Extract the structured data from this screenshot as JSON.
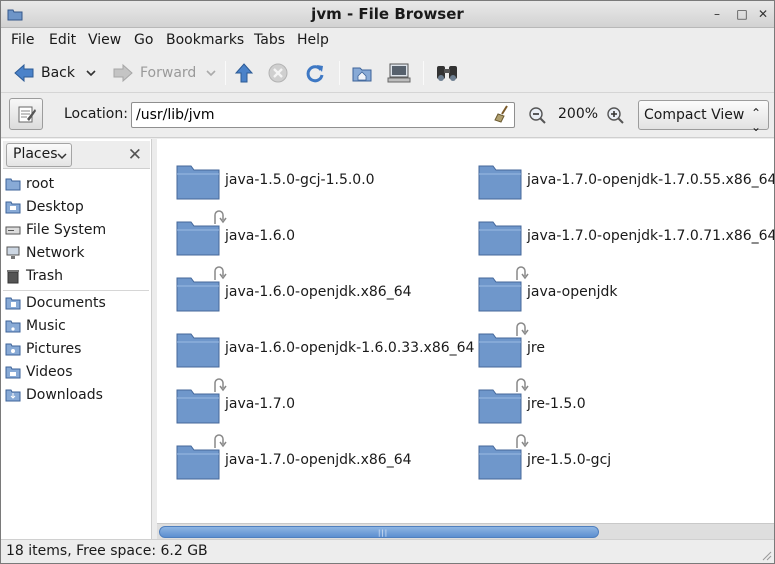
{
  "window": {
    "title": "jvm - File Browser"
  },
  "menubar": [
    "File",
    "Edit",
    "View",
    "Go",
    "Bookmarks",
    "Tabs",
    "Help"
  ],
  "toolbar": {
    "back_label": "Back",
    "forward_label": "Forward"
  },
  "location": {
    "label": "Location:",
    "value": "/usr/lib/jvm",
    "zoom": "200%",
    "view": "Compact View"
  },
  "sidebar": {
    "header": "Places",
    "group1": [
      "root",
      "Desktop",
      "File System",
      "Network",
      "Trash"
    ],
    "group2": [
      "Documents",
      "Music",
      "Pictures",
      "Videos",
      "Downloads"
    ]
  },
  "files": [
    {
      "name": "java-1.5.0-gcj-1.5.0.0",
      "link": false
    },
    {
      "name": "java-1.6.0",
      "link": true
    },
    {
      "name": "java-1.6.0-openjdk.x86_64",
      "link": true
    },
    {
      "name": "java-1.6.0-openjdk-1.6.0.33.x86_64",
      "link": false
    },
    {
      "name": "java-1.7.0",
      "link": true
    },
    {
      "name": "java-1.7.0-openjdk.x86_64",
      "link": true
    },
    {
      "name": "java-1.7.0-openjdk-1.7.0.55.x86_64",
      "link": false
    },
    {
      "name": "java-1.7.0-openjdk-1.7.0.71.x86_64",
      "link": false
    },
    {
      "name": "java-openjdk",
      "link": true
    },
    {
      "name": "jre",
      "link": true
    },
    {
      "name": "jre-1.5.0",
      "link": true
    },
    {
      "name": "jre-1.5.0-gcj",
      "link": true
    }
  ],
  "status": {
    "text": "18 items, Free space: 6.2 GB"
  }
}
